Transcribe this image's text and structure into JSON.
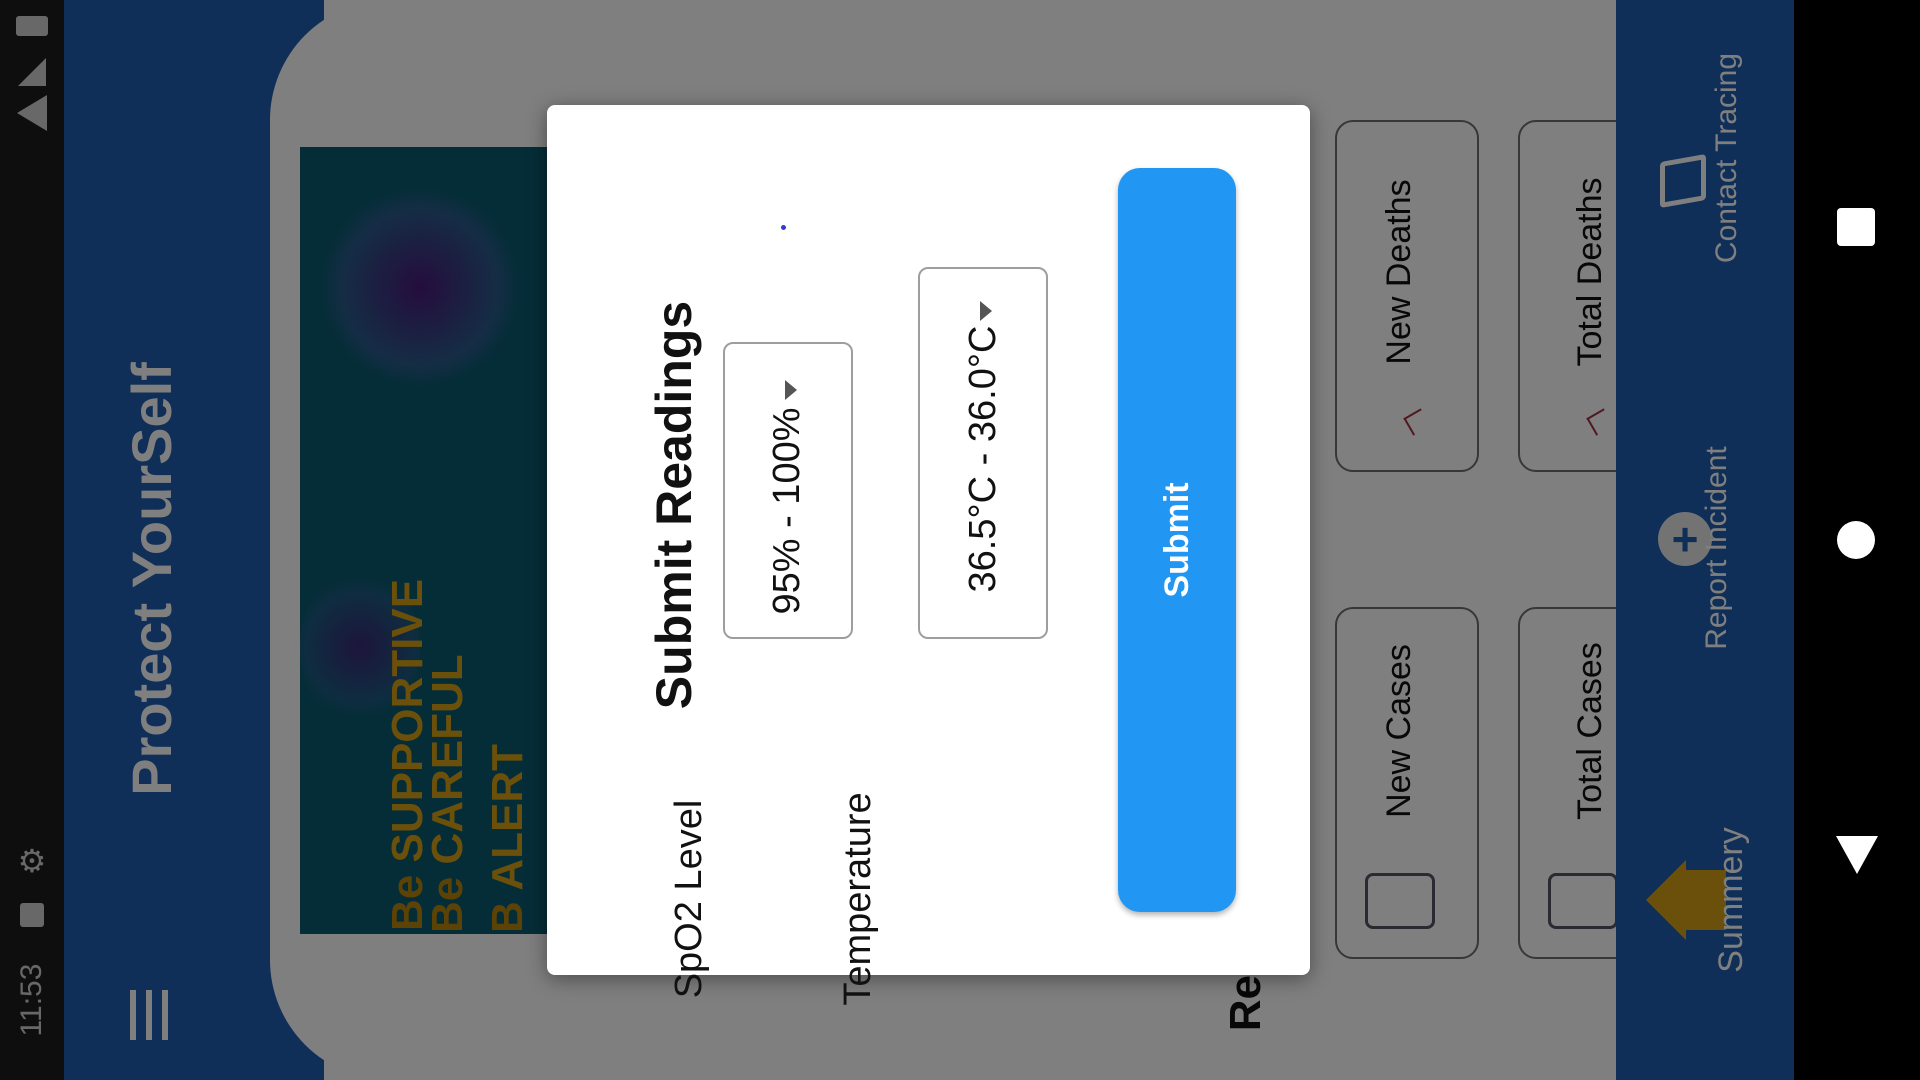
{
  "status_bar": {
    "time": "11:53"
  },
  "app_bar": {
    "title": "Protect YourSelf",
    "menu_icon": "hamburger-icon"
  },
  "banner": {
    "line1_prefix": "Be",
    "line1_word": "SUPPORTIVE",
    "line2_prefix": "Be",
    "line2_word": "CAREFUL",
    "line3_prefix": "B",
    "line3_word": "ALERT"
  },
  "section_title_partial": "Re",
  "cards": [
    {
      "label": "New Deaths"
    },
    {
      "label": "Total Deaths"
    },
    {
      "label": "New Cases"
    },
    {
      "label": "Total Cases"
    }
  ],
  "bottom_nav": [
    {
      "label": "Summery",
      "icon": "home-icon"
    },
    {
      "label": "Report Incident",
      "icon": "plus-circle-icon"
    },
    {
      "label": "Contact Tracing",
      "icon": "map-icon"
    }
  ],
  "dialog": {
    "title": "Submit Readings",
    "spo2": {
      "label": "SpO2 Level",
      "value": "95% - 100%"
    },
    "temperature": {
      "label": "Temperature",
      "value": "36.5°C - 36.0°C"
    },
    "submit_label": "Submit"
  },
  "colors": {
    "primary": "#1f5fb0",
    "accent": "#2196f3",
    "gold": "#d4a017",
    "banner": "#0b5a70"
  }
}
